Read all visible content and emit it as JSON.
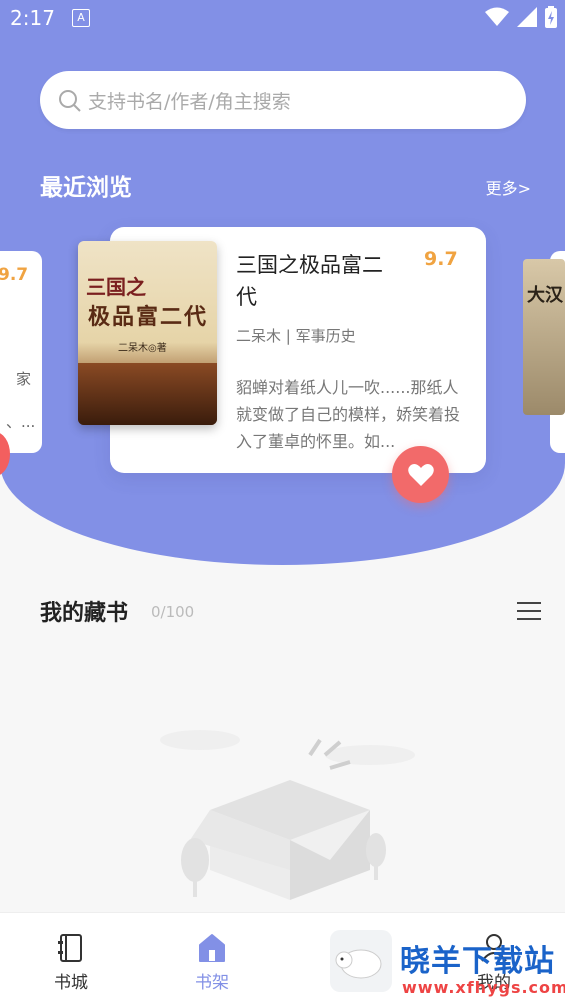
{
  "status_bar": {
    "time": "2:17",
    "indicator": "A"
  },
  "search": {
    "placeholder": "支持书名/作者/角主搜索"
  },
  "recent": {
    "title": "最近浏览",
    "more_label": "更多>",
    "left_card": {
      "rating": "9.7",
      "text1": "家",
      "text2": "、..."
    },
    "main_card": {
      "cover_title_top": "三国之",
      "cover_title_main": "极品富二代",
      "cover_author": "二呆木◎著",
      "title": "三国之极品富二代",
      "rating": "9.7",
      "meta": "二呆木 | 军事历史",
      "description": "貂蝉对着纸人儿一吹......那纸人就变做了自己的模样，娇笑着投入了董卓的怀里。如..."
    },
    "right_card": {
      "cover_text": "大汉"
    }
  },
  "shelf": {
    "title": "我的藏书",
    "count": "0/100"
  },
  "tabs": [
    {
      "label": "书城",
      "icon": "bookstore-icon",
      "active": false
    },
    {
      "label": "书架",
      "icon": "bookshelf-icon",
      "active": true
    },
    {
      "label": "我的",
      "icon": "profile-icon",
      "active": false
    }
  ],
  "watermark": {
    "name": "晓羊下载站",
    "url": "www.xfhygs.com"
  },
  "colors": {
    "accent": "#8290e6",
    "rating": "#f0a341",
    "heart": "#f26a6a"
  }
}
